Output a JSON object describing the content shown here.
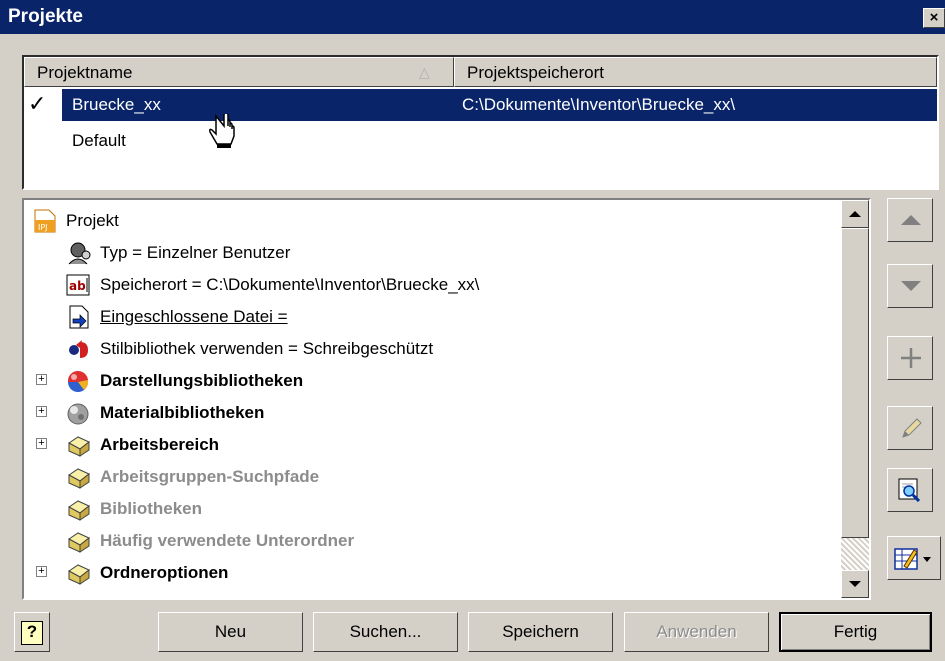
{
  "window": {
    "title": "Projekte",
    "close_glyph": "×"
  },
  "project_list": {
    "columns": [
      "Projektname",
      "Projektspeicherort"
    ],
    "rows": [
      {
        "name": "Bruecke_xx",
        "location": "C:\\Dokumente\\Inventor\\Bruecke_xx\\",
        "active": "✓",
        "selected": true
      },
      {
        "name": "Default",
        "location": "",
        "active": "",
        "selected": false
      }
    ]
  },
  "tree": {
    "items": [
      {
        "label": "Projekt",
        "icon": "ipj-file-icon"
      },
      {
        "label": "Typ = Einzelner Benutzer",
        "icon": "user-icon"
      },
      {
        "label": "Speicherort = C:\\Dokumente\\Inventor\\Bruecke_xx\\",
        "icon": "text-field-icon"
      },
      {
        "label": "Eingeschlossene Datei = ",
        "icon": "included-file-icon"
      },
      {
        "label": "Stilbibliothek verwenden = Schreibgeschützt",
        "icon": "style-library-icon"
      },
      {
        "label": "Darstellungsbibliotheken",
        "icon": "appearance-library-icon"
      },
      {
        "label": "Materialbibliotheken",
        "icon": "material-library-icon"
      },
      {
        "label": "Arbeitsbereich",
        "icon": "folder-icon"
      },
      {
        "label": "Arbeitsgruppen-Suchpfade",
        "icon": "folder-icon"
      },
      {
        "label": "Bibliotheken",
        "icon": "folder-icon"
      },
      {
        "label": "Häufig verwendete Unterordner",
        "icon": "folder-icon"
      },
      {
        "label": "Ordneroptionen",
        "icon": "folder-icon"
      }
    ]
  },
  "buttons": {
    "help": "?",
    "new": "Neu",
    "search": "Suchen...",
    "save": "Speichern",
    "apply": "Anwenden",
    "done": "Fertig"
  },
  "colors": {
    "title_bar": "#0a246a",
    "selection": "#0a246a",
    "face": "#d4d0c8",
    "disabled_text": "#8c8c8c"
  }
}
